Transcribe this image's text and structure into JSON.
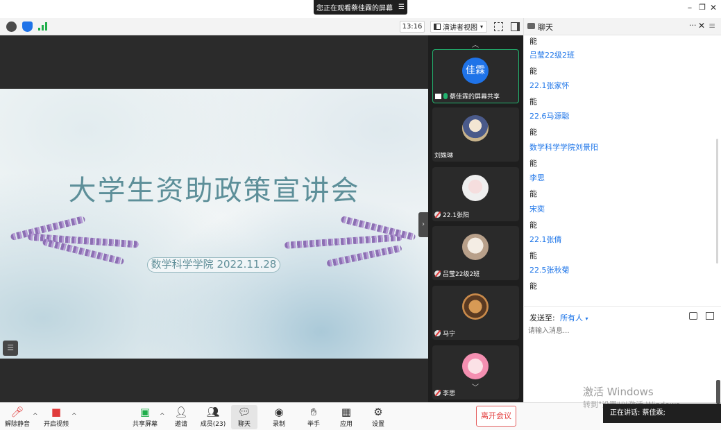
{
  "titlebar": {
    "share_banner": "您正在观看蔡佳霖的屏幕",
    "banner_menu": "☰",
    "minimize": "–",
    "restore": "❐",
    "close": "✕"
  },
  "topbar": {
    "time": "13:16",
    "view_mode": "演讲者视图",
    "view_caret": "▾"
  },
  "chat_header": {
    "title": "聊天",
    "more": "···",
    "close": "✕",
    "menu": "≡"
  },
  "slide": {
    "title": "大学生资助政策宣讲会",
    "subtitle": "数学科学学院  2022.11.28"
  },
  "participants": [
    {
      "name": "蔡佳霖的屏幕共享",
      "avatar_text": "佳霖",
      "active": true
    },
    {
      "name": "刘姝琳",
      "avatar_text": ""
    },
    {
      "name": "22.1张阳",
      "avatar_text": ""
    },
    {
      "name": "吕莹22级2班",
      "avatar_text": ""
    },
    {
      "name": "马宁",
      "avatar_text": ""
    },
    {
      "name": "李思",
      "avatar_text": ""
    }
  ],
  "chat": {
    "messages": [
      {
        "text": "能"
      },
      {
        "name": "吕莹22级2班",
        "text": "能"
      },
      {
        "name": "22.1张家怀",
        "text": "能"
      },
      {
        "name": "22.6马源聪",
        "text": "能"
      },
      {
        "name": "数学科学学院刘景阳",
        "text": "能"
      },
      {
        "name": "李思",
        "text": "能"
      },
      {
        "name": "宋奕",
        "text": "能"
      },
      {
        "name": "22.1张倩",
        "text": "能"
      },
      {
        "name": "22.5张秋菊",
        "text": "能"
      }
    ],
    "send_to_label": "发送至:",
    "send_to_value": "所有人",
    "send_to_caret": "▾",
    "input_placeholder": "请输入消息..."
  },
  "toolbar": {
    "unmute": "解除静音",
    "start_video": "开启视频",
    "share_screen": "共享屏幕",
    "invite": "邀请",
    "members": "成员(23)",
    "chat": "聊天",
    "record": "录制",
    "raise_hand": "举手",
    "apps": "应用",
    "settings": "设置",
    "leave": "离开会议"
  },
  "overlay": {
    "activate_title": "激活 Windows",
    "activate_hint": "转到\"设置\"以激活 Windows。",
    "talking": "正在讲话: 蔡佳霖;"
  },
  "colors": {
    "accent_blue": "#1a73e8",
    "active_green": "#22b36f",
    "leave_red": "#e34040",
    "dark_bg": "#2b2b2b"
  }
}
